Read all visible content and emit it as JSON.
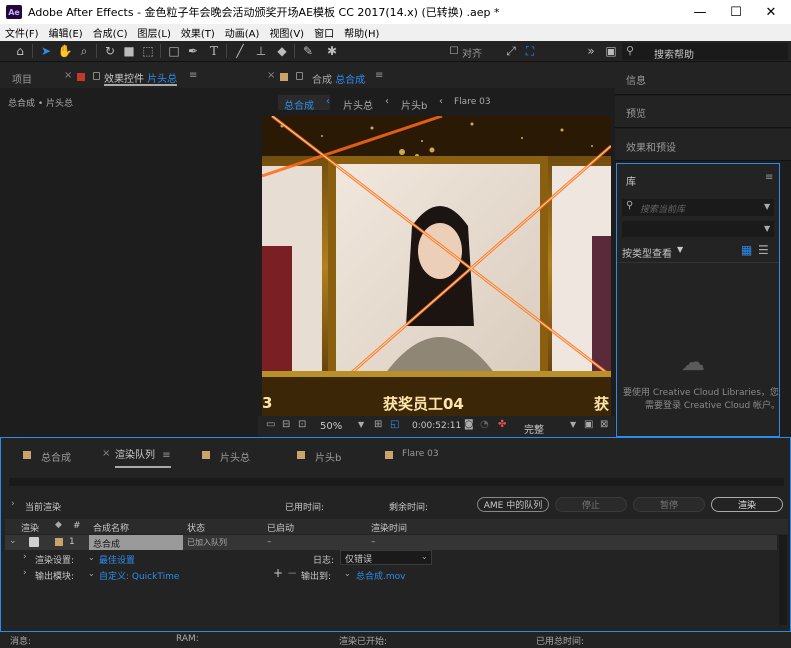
{
  "window": {
    "title": "Adobe After Effects - 金色粒子年会晚会活动颁奖开场AE模板 CC 2017(14.x) (已转换) .aep *",
    "logo": "Ae",
    "minimize": "—",
    "maximize": "☐",
    "close": "✕"
  },
  "menu": [
    "文件(F)",
    "编辑(E)",
    "合成(C)",
    "图层(L)",
    "效果(T)",
    "动画(A)",
    "视图(V)",
    "窗口",
    "帮助(H)"
  ],
  "toolbar": {
    "snap_label": "对齐",
    "search_label": "搜索帮助"
  },
  "left_panel": {
    "tab_project": "项目",
    "tab_effects_prefix": "效果控件",
    "tab_effects_target": "片头总",
    "breadcrumb": "总合成 • 片头总"
  },
  "comp_panel": {
    "tab_prefix": "合成",
    "tab_name": "总合成",
    "crumbs": [
      "总合成",
      "片头总",
      "片头b",
      "Flare 03"
    ],
    "viewer": {
      "banner_text": "获奖员工04",
      "left_num": "3",
      "right_char": "获"
    },
    "footer": {
      "zoom": "50%",
      "timecode": "0:00:52:11",
      "quality": "完整"
    }
  },
  "right_panel": {
    "items": [
      "信息",
      "预览",
      "效果和预设"
    ],
    "library_title": "库",
    "library_search_placeholder": "搜索当前库",
    "view_by": "按类型查看",
    "cc_message_line1": "要使用 Creative Cloud Libraries，您",
    "cc_message_line2": "需要登录 Creative Cloud 帐户。"
  },
  "bottom_tabs": [
    {
      "label": "总合成",
      "color": "#c9a36a"
    },
    {
      "label": "渲染队列",
      "color": "",
      "active": true
    },
    {
      "label": "片头总",
      "color": "#c9a36a"
    },
    {
      "label": "片头b",
      "color": "#c9a36a"
    },
    {
      "label": "Flare 03",
      "color": "#c9a36a"
    }
  ],
  "render_queue": {
    "current_render_label": "当前渲染",
    "elapsed_label": "已用时间:",
    "remaining_label": "剩余时间:",
    "ame_button": "AME 中的队列",
    "stop_button": "停止",
    "pause_button": "暂停",
    "render_button": "渲染",
    "columns": {
      "render": "渲染",
      "hash": "#",
      "comp_name": "合成名称",
      "status": "状态",
      "started": "已启动",
      "render_time": "渲染时间"
    },
    "item": {
      "index": "1",
      "comp_name": "总合成",
      "status": "已加入队列",
      "started": "–",
      "render_time": "–"
    },
    "render_settings_label": "渲染设置:",
    "render_settings_value": "最佳设置",
    "log_label": "日志:",
    "log_value": "仅错误",
    "output_module_label": "输出模块:",
    "output_module_value": "自定义: QuickTime",
    "output_to_label": "输出到:",
    "output_to_value": "总合成.mov"
  },
  "status_bar": {
    "message": "消息:",
    "ram": "RAM:",
    "renders_started": "渲染已开始:",
    "total_time": "已用总时间:"
  }
}
